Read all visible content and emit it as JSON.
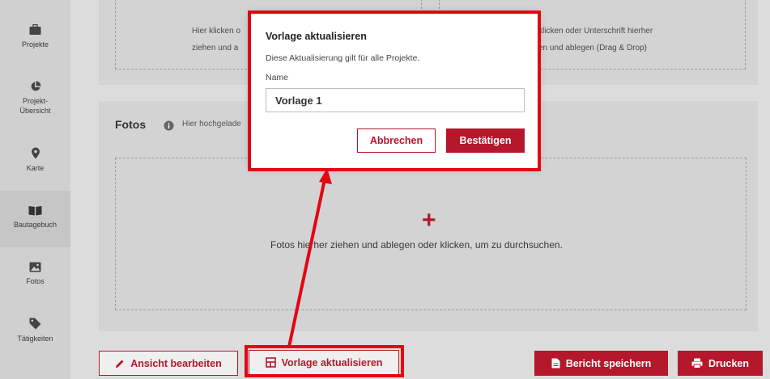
{
  "sidebar": {
    "items": [
      {
        "label": "Projekte",
        "icon": "briefcase-icon"
      },
      {
        "label": "Projekt-Übersicht",
        "icon": "pie-chart-icon"
      },
      {
        "label": "Karte",
        "icon": "map-pin-icon"
      },
      {
        "label": "Bautagebuch",
        "icon": "book-icon",
        "active": true
      },
      {
        "label": "Fotos",
        "icon": "image-icon"
      },
      {
        "label": "Tätigkeiten",
        "icon": "tag-icon"
      }
    ],
    "projekt_line1": "Projekt-",
    "projekt_line2": "Übersicht"
  },
  "signature_area": {
    "left_line1": "Hier klicken o",
    "left_line2": "ziehen und a",
    "right_line1": "klicken oder Unterschrift hierher",
    "right_line2": "en und ablegen (Drag & Drop)"
  },
  "fotos": {
    "title": "Fotos",
    "hint": "Hier hochgelade",
    "plus": "+",
    "drop_text": "Fotos hierher ziehen und ablegen oder klicken, um zu durchsuchen."
  },
  "bottom_bar": {
    "edit_view": "Ansicht bearbeiten",
    "update_template": "Vorlage aktualisieren",
    "save_report": "Bericht speichern",
    "print": "Drucken"
  },
  "modal": {
    "title": "Vorlage aktualisieren",
    "description": "Diese Aktualisierung gilt für alle Projekte.",
    "name_label": "Name",
    "name_value": "Vorlage 1",
    "cancel": "Abbrechen",
    "confirm": "Bestätigen"
  },
  "colors": {
    "accent": "#b5172b",
    "highlight": "#e30613"
  }
}
